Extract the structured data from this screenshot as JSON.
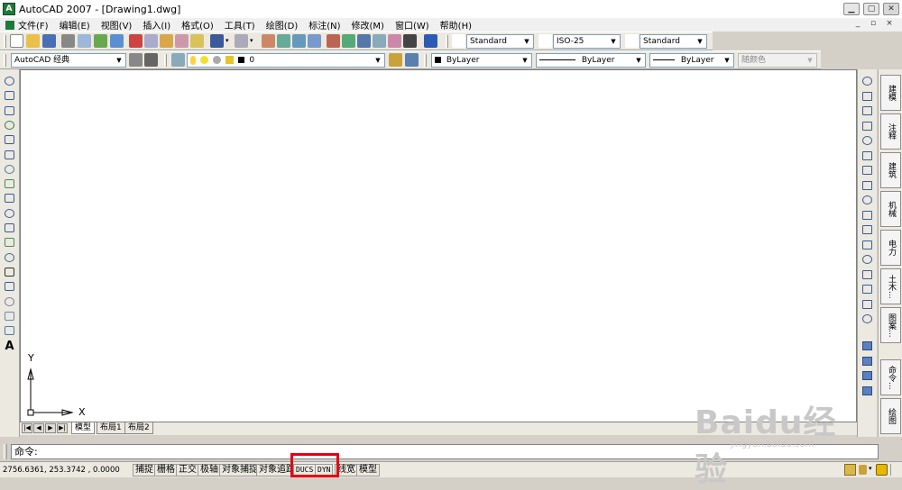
{
  "window": {
    "app_icon": "A",
    "title": "AutoCAD 2007 - [Drawing1.dwg]"
  },
  "menu": [
    "文件(F)",
    "编辑(E)",
    "视图(V)",
    "插入(I)",
    "格式(O)",
    "工具(T)",
    "绘图(D)",
    "标注(N)",
    "修改(M)",
    "窗口(W)",
    "帮助(H)"
  ],
  "toolbar1": {
    "text_style": "Standard",
    "dim_style": "ISO-25",
    "table_style": "Standard"
  },
  "toolbar2": {
    "workspace": "AutoCAD 经典",
    "layer": "0",
    "color": "ByLayer",
    "linetype": "ByLayer",
    "lineweight": "ByLayer",
    "plotstyle": "随颜色"
  },
  "left_tools_icons": [
    "line-icon",
    "construction-line-icon",
    "polyline-icon",
    "polygon-icon",
    "rectangle-icon",
    "arc-icon",
    "circle-icon",
    "revision-cloud-icon",
    "spline-icon",
    "ellipse-icon",
    "ellipse-arc-icon",
    "insert-block-icon",
    "make-block-icon",
    "point-icon",
    "hatch-icon",
    "gradient-icon",
    "region-icon",
    "table-icon",
    "multiline-text-icon"
  ],
  "right_tools_icons": [
    "erase-icon",
    "copy-icon",
    "mirror-icon",
    "offset-icon",
    "array-icon",
    "move-icon",
    "rotate-icon",
    "scale-icon",
    "stretch-icon",
    "trim-icon",
    "extend-icon",
    "break-at-point-icon",
    "break-icon",
    "join-icon",
    "chamfer-icon",
    "fillet-icon",
    "explode-icon"
  ],
  "right_tools2_icons": [
    "draworder-front-icon",
    "draworder-back-icon",
    "draworder-above-icon",
    "draworder-under-icon"
  ],
  "palette_tabs": [
    "建模",
    "注释",
    "建筑",
    "机械",
    "电力",
    "土木...",
    "图案...",
    "命令...",
    "绘图"
  ],
  "ucs": {
    "x_label": "X",
    "y_label": "Y"
  },
  "layout_tabs": [
    "模型",
    "布局1",
    "布局2"
  ],
  "command": {
    "prompt": "命令:"
  },
  "status": {
    "coords": "2756.6361, 253.3742 , 0.0000",
    "buttons": [
      "捕捉",
      "栅格",
      "正交",
      "极轴",
      "对象捕捉",
      "对象追踪",
      "DUCS",
      "DYN",
      "线宽",
      "模型"
    ]
  },
  "watermark": {
    "line1": "Baidu经验",
    "line2": "jingyan.baidu.com"
  },
  "colors": {
    "highlight": "#e60012",
    "canvas": "#ffffff",
    "chrome": "#ece9e0"
  }
}
